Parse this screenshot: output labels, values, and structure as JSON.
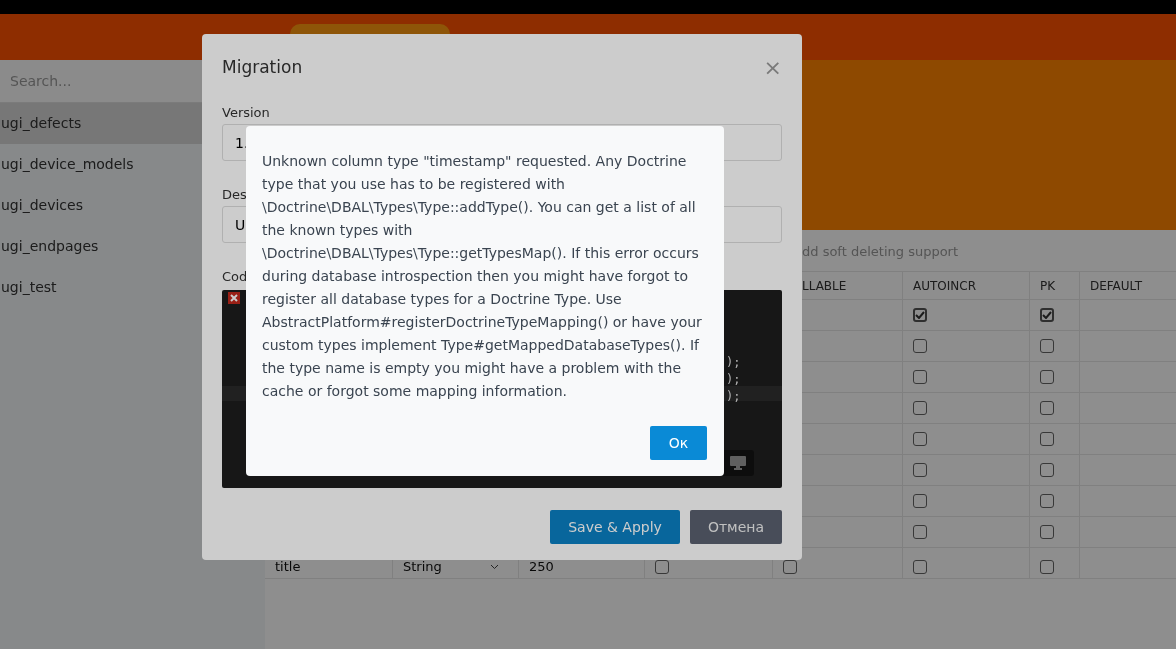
{
  "sidebar": {
    "search": {
      "placeholder": "Search..."
    },
    "items": [
      {
        "label": "ugi_defects",
        "selected": true
      },
      {
        "label": "ugi_device_models",
        "selected": false
      },
      {
        "label": "ugi_devices",
        "selected": false
      },
      {
        "label": "ugi_endpages",
        "selected": false
      },
      {
        "label": "ugi_test",
        "selected": false
      }
    ]
  },
  "description": "dd soft deleting support",
  "table": {
    "columns": [
      "",
      "",
      "",
      "",
      "LLABLE",
      "AUTOINCR",
      "PK",
      "DEFAULT"
    ],
    "rows": [
      {
        "autoincr": true,
        "pk": true
      },
      {
        "autoincr": false,
        "pk": false
      },
      {
        "autoincr": false,
        "pk": false
      },
      {
        "autoincr": false,
        "pk": false
      },
      {
        "autoincr": false,
        "pk": false
      },
      {
        "autoincr": false,
        "pk": false
      },
      {
        "autoincr": false,
        "pk": false
      },
      {
        "autoincr": false,
        "pk": false
      },
      {
        "name": "title",
        "type": "String",
        "length": "250",
        "column_4": false,
        "nullable": false,
        "autoincr": false,
        "pk": false
      }
    ]
  },
  "modal": {
    "title": "Migration",
    "close": "×",
    "fields": [
      {
        "label": "Version",
        "value": "1."
      },
      {
        "label": "Des",
        "value": "U"
      }
    ],
    "code_label": "Cod",
    "code_lines": [
      ");",
      ");",
      ");"
    ],
    "buttons": [
      {
        "label": "Save & Apply",
        "kind": "primary"
      },
      {
        "label": "Отмена",
        "kind": "secondary"
      }
    ]
  },
  "alert": {
    "message": "Unknown column type \"timestamp\" requested. Any Doctrine type that you use has to be registered with \\Doctrine\\DBAL\\Types\\Type::addType(). You can get a list of all the known types with \\Doctrine\\DBAL\\Types\\Type::getTypesMap(). If this error occurs during database introspection then you might have forgot to register all database types for a Doctrine Type. Use AbstractPlatform#registerDoctrineTypeMapping() or have your custom types implement Type#getMappedDatabaseTypes(). If the type name is empty you might have a problem with the cache or forgot some mapping information.",
    "button": "Ок"
  }
}
